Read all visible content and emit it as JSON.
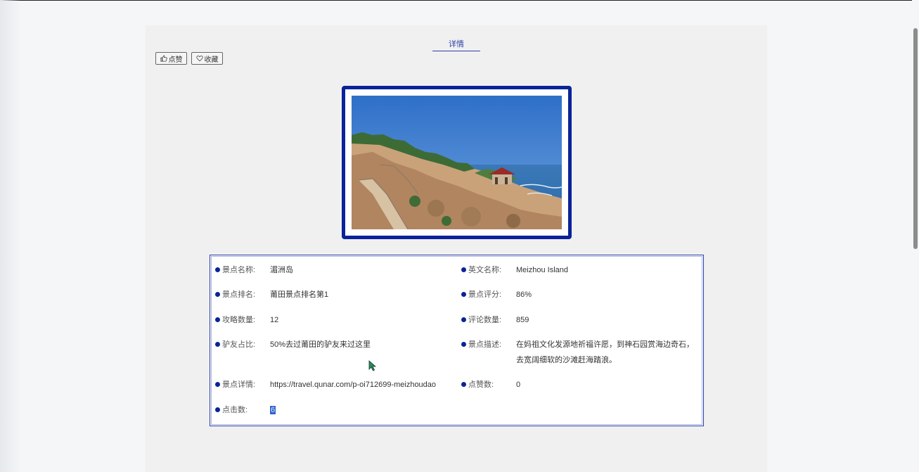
{
  "header": {
    "title": "详情"
  },
  "actions": {
    "like_label": "点赞",
    "favorite_label": "收藏"
  },
  "photo": {
    "alt": "湄洲岛"
  },
  "details": {
    "rows": [
      {
        "label": "景点名称:",
        "value": "湄洲岛"
      },
      {
        "label": "英文名称:",
        "value": "Meizhou Island"
      },
      {
        "label": "景点排名:",
        "value": "莆田景点排名第1"
      },
      {
        "label": "景点评分:",
        "value": "86%"
      },
      {
        "label": "攻略数量:",
        "value": "12"
      },
      {
        "label": "评论数量:",
        "value": "859"
      },
      {
        "label": "驴友占比:",
        "value": "50%去过莆田的驴友来过这里"
      },
      {
        "label": "景点描述:",
        "value": "在妈祖文化发源地祈福许愿，到神石园赏海边奇石，去宽阔细软的沙滩赶海踏浪。"
      },
      {
        "label": "景点详情:",
        "value": "https://travel.qunar.com/p-oi712699-meizhoudao"
      },
      {
        "label": "点赞数:",
        "value": "0"
      },
      {
        "label": "点击数:",
        "value": "6"
      }
    ]
  },
  "colors": {
    "accent": "#0a2399",
    "link": "#2b3fa8",
    "panel": "#f0f0f0"
  }
}
